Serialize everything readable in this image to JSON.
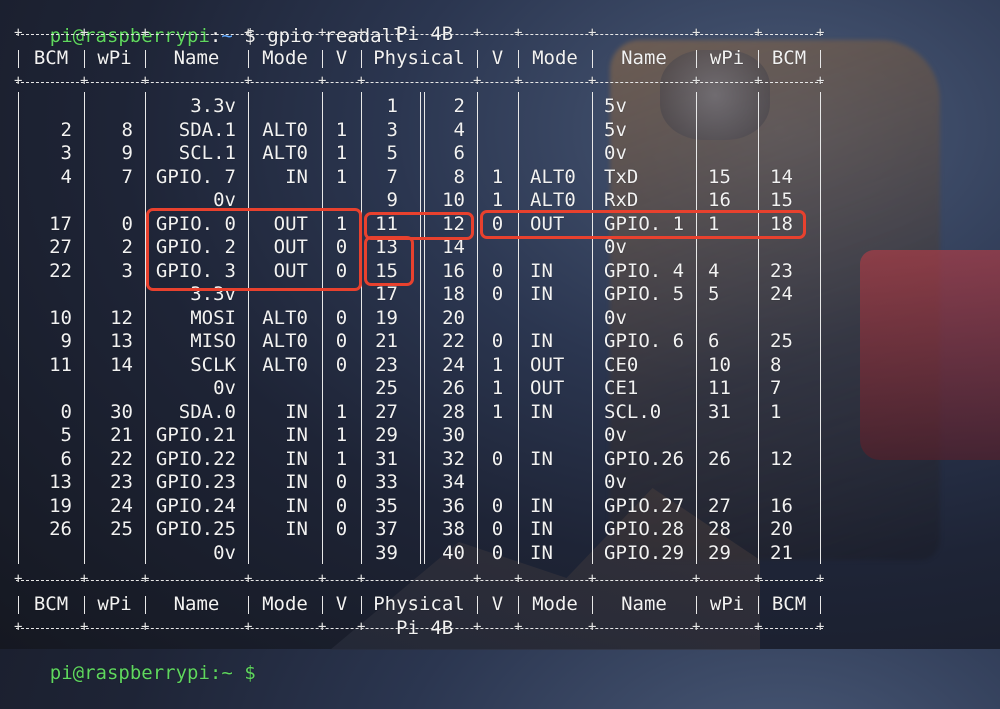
{
  "prompt": {
    "user_host": "pi@raspberrypi",
    "sep": ":",
    "path": "~",
    "symbol": "$",
    "command": "gpio readall"
  },
  "banner": "Pi 4B",
  "headers": [
    "BCM",
    "wPi",
    "Name",
    "Mode",
    "V",
    "Physical",
    "V",
    "Mode",
    "Name",
    "wPi",
    "BCM"
  ],
  "rows": [
    [
      "",
      "",
      "3.3v",
      "",
      "",
      "1",
      "2",
      "",
      "",
      "5v",
      "",
      ""
    ],
    [
      "2",
      "8",
      "SDA.1",
      "ALT0",
      "1",
      "3",
      "4",
      "",
      "",
      "5v",
      "",
      ""
    ],
    [
      "3",
      "9",
      "SCL.1",
      "ALT0",
      "1",
      "5",
      "6",
      "",
      "",
      "0v",
      "",
      ""
    ],
    [
      "4",
      "7",
      "GPIO. 7",
      "IN",
      "1",
      "7",
      "8",
      "1",
      "ALT0",
      "TxD",
      "15",
      "14"
    ],
    [
      "",
      "",
      "0v",
      "",
      "",
      "9",
      "10",
      "1",
      "ALT0",
      "RxD",
      "16",
      "15"
    ],
    [
      "17",
      "0",
      "GPIO. 0",
      "OUT",
      "1",
      "11",
      "12",
      "0",
      "OUT",
      "GPIO. 1",
      "1",
      "18"
    ],
    [
      "27",
      "2",
      "GPIO. 2",
      "OUT",
      "0",
      "13",
      "14",
      "",
      "",
      "0v",
      "",
      ""
    ],
    [
      "22",
      "3",
      "GPIO. 3",
      "OUT",
      "0",
      "15",
      "16",
      "0",
      "IN",
      "GPIO. 4",
      "4",
      "23"
    ],
    [
      "",
      "",
      "3.3v",
      "",
      "",
      "17",
      "18",
      "0",
      "IN",
      "GPIO. 5",
      "5",
      "24"
    ],
    [
      "10",
      "12",
      "MOSI",
      "ALT0",
      "0",
      "19",
      "20",
      "",
      "",
      "0v",
      "",
      ""
    ],
    [
      "9",
      "13",
      "MISO",
      "ALT0",
      "0",
      "21",
      "22",
      "0",
      "IN",
      "GPIO. 6",
      "6",
      "25"
    ],
    [
      "11",
      "14",
      "SCLK",
      "ALT0",
      "0",
      "23",
      "24",
      "1",
      "OUT",
      "CE0",
      "10",
      "8"
    ],
    [
      "",
      "",
      "0v",
      "",
      "",
      "25",
      "26",
      "1",
      "OUT",
      "CE1",
      "11",
      "7"
    ],
    [
      "0",
      "30",
      "SDA.0",
      "IN",
      "1",
      "27",
      "28",
      "1",
      "IN",
      "SCL.0",
      "31",
      "1"
    ],
    [
      "5",
      "21",
      "GPIO.21",
      "IN",
      "1",
      "29",
      "30",
      "",
      "",
      "0v",
      "",
      ""
    ],
    [
      "6",
      "22",
      "GPIO.22",
      "IN",
      "1",
      "31",
      "32",
      "0",
      "IN",
      "GPIO.26",
      "26",
      "12"
    ],
    [
      "13",
      "23",
      "GPIO.23",
      "IN",
      "0",
      "33",
      "34",
      "",
      "",
      "0v",
      "",
      ""
    ],
    [
      "19",
      "24",
      "GPIO.24",
      "IN",
      "0",
      "35",
      "36",
      "0",
      "IN",
      "GPIO.27",
      "27",
      "16"
    ],
    [
      "26",
      "25",
      "GPIO.25",
      "IN",
      "0",
      "37",
      "38",
      "0",
      "IN",
      "GPIO.28",
      "28",
      "20"
    ],
    [
      "",
      "",
      "0v",
      "",
      "",
      "39",
      "40",
      "0",
      "IN",
      "GPIO.29",
      "29",
      "21"
    ]
  ],
  "next_prompt": "pi@raspberrypi:~ $",
  "colors": {
    "highlight": "#e8412e",
    "prompt": "#5fd75f",
    "path": "#5fa8ff",
    "text": "#f2f2f2"
  }
}
